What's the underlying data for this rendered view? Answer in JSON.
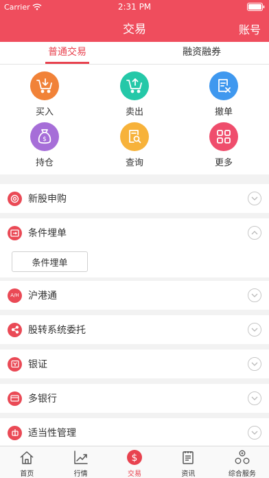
{
  "status_bar": {
    "carrier": "Carrier",
    "time": "2:31 PM"
  },
  "nav": {
    "title": "交易",
    "right_action": "账号"
  },
  "tabs": [
    {
      "label": "普通交易",
      "active": true
    },
    {
      "label": "融资融券",
      "active": false
    }
  ],
  "grid": [
    {
      "label": "买入",
      "icon": "cart-in-icon",
      "color": "#f18238"
    },
    {
      "label": "卖出",
      "icon": "cart-out-icon",
      "color": "#25c8a8"
    },
    {
      "label": "撤单",
      "icon": "cancel-order-icon",
      "color": "#3f98ef"
    },
    {
      "label": "持仓",
      "icon": "money-bag-icon",
      "color": "#a66ed8"
    },
    {
      "label": "查询",
      "icon": "document-search-icon",
      "color": "#f7b23a"
    },
    {
      "label": "更多",
      "icon": "grid-more-icon",
      "color": "#ef4d6c"
    }
  ],
  "menu": [
    {
      "label": "新股申购",
      "icon": "new-stock-icon",
      "expanded": false
    },
    {
      "label": "条件埋单",
      "icon": "conditional-order-icon",
      "expanded": true
    },
    {
      "label": "沪港通",
      "icon": "ah-icon",
      "icon_text": "A/H",
      "expanded": false
    },
    {
      "label": "股转系统委托",
      "icon": "share-icon",
      "expanded": false
    },
    {
      "label": "银证",
      "icon": "bank-securities-icon",
      "expanded": false
    },
    {
      "label": "多银行",
      "icon": "card-icon",
      "expanded": false
    },
    {
      "label": "适当性管理",
      "icon": "suitability-icon",
      "expanded": false
    }
  ],
  "submenu": {
    "button_label": "条件埋单"
  },
  "tabbar": [
    {
      "label": "首页",
      "icon": "home-icon",
      "active": false
    },
    {
      "label": "行情",
      "icon": "trend-chart-icon",
      "active": false
    },
    {
      "label": "交易",
      "icon": "dollar-icon",
      "active": true
    },
    {
      "label": "资讯",
      "icon": "news-icon",
      "active": false
    },
    {
      "label": "综合服务",
      "icon": "services-icon",
      "active": false
    }
  ],
  "colors": {
    "brand_red": "#ef4d5d",
    "accent_red": "#e8424f"
  }
}
